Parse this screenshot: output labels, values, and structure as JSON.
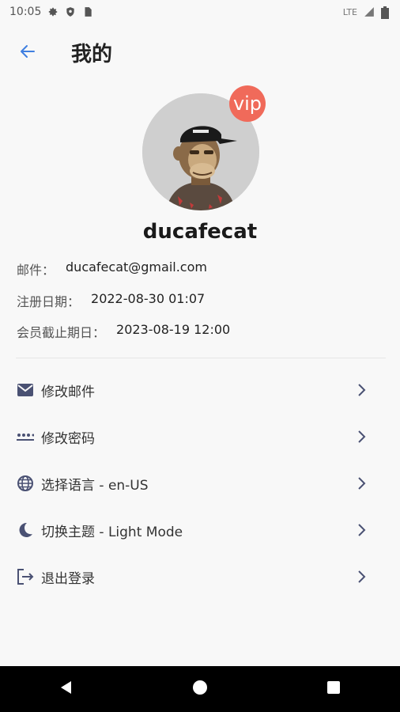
{
  "status_bar": {
    "time": "10:05",
    "network": "LTE",
    "icons": [
      "gear-icon",
      "shield-icon",
      "sim-card-icon",
      "signal-icon",
      "battery-icon"
    ]
  },
  "header": {
    "title": "我的",
    "back_icon": "arrow-left-icon"
  },
  "profile": {
    "badge": "vip",
    "username": "ducafecat",
    "avatar": "ape-avatar"
  },
  "info": [
    {
      "label": "邮件：",
      "value": "ducafecat@gmail.com"
    },
    {
      "label": "注册日期：",
      "value": "2022-08-30 01:07"
    },
    {
      "label": "会员截止期日：",
      "value": "2023-08-19 12:00"
    }
  ],
  "menu": [
    {
      "icon": "mail-icon",
      "label": "修改邮件"
    },
    {
      "icon": "password-icon",
      "label": "修改密码"
    },
    {
      "icon": "globe-icon",
      "label": "选择语言 - en-US"
    },
    {
      "icon": "moon-icon",
      "label": "切换主题 - Light Mode"
    },
    {
      "icon": "logout-icon",
      "label": "退出登录"
    }
  ],
  "colors": {
    "accent": "#3f7fe0",
    "vip_badge": "#f06a5a",
    "icon": "#4a5173",
    "background": "#f8f8f8",
    "nav_bar": "#000000"
  }
}
